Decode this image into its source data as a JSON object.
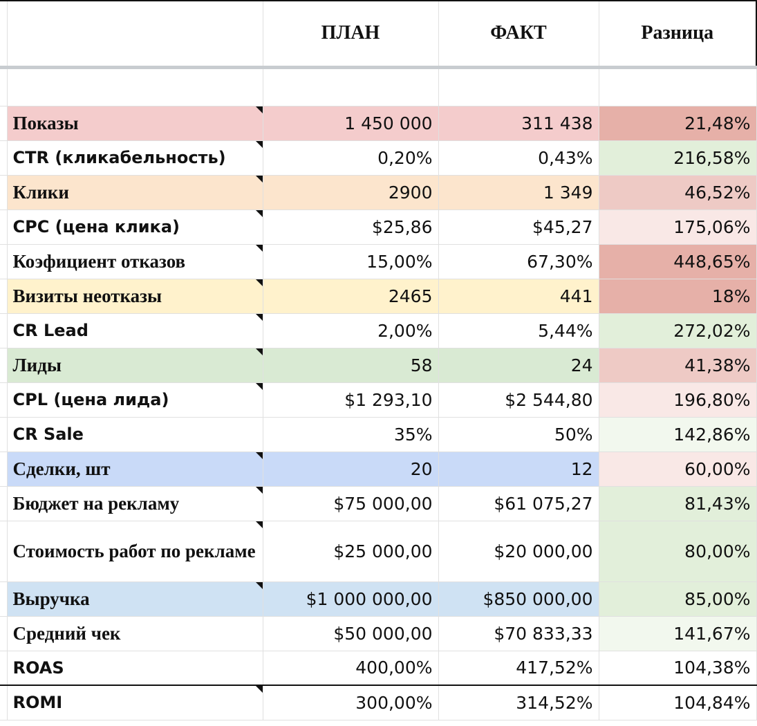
{
  "header": {
    "plan": "ПЛАН",
    "fact": "ФАКТ",
    "diff": "Разница"
  },
  "rows": [
    {
      "label": "Показы",
      "plan": "1 450 000",
      "fact": "311 438",
      "diff": "21,48%"
    },
    {
      "label": "CTR (кликабельность)",
      "plan": "0,20%",
      "fact": "0,43%",
      "diff": "216,58%"
    },
    {
      "label": "Клики",
      "plan": "2900",
      "fact": "1 349",
      "diff": "46,52%"
    },
    {
      "label": "CPC (цена клика)",
      "plan": "$25,86",
      "fact": "$45,27",
      "diff": "175,06%"
    },
    {
      "label": "Коэфициент отказов",
      "plan": "15,00%",
      "fact": "67,30%",
      "diff": "448,65%"
    },
    {
      "label": "Визиты неотказы",
      "plan": "2465",
      "fact": "441",
      "diff": "18%"
    },
    {
      "label": "CR Lead",
      "plan": "2,00%",
      "fact": "5,44%",
      "diff": "272,02%"
    },
    {
      "label": "Лиды",
      "plan": "58",
      "fact": "24",
      "diff": "41,38%"
    },
    {
      "label": "CPL (цена лида)",
      "plan": "$1 293,10",
      "fact": "$2 544,80",
      "diff": "196,80%"
    },
    {
      "label": "CR Sale",
      "plan": "35%",
      "fact": "50%",
      "diff": "142,86%"
    },
    {
      "label": "Сделки, шт",
      "plan": "20",
      "fact": "12",
      "diff": "60,00%"
    },
    {
      "label": "Бюджет на рекламу",
      "plan": "$75 000,00",
      "fact": "$61 075,27",
      "diff": "81,43%"
    },
    {
      "label": "Стоимость работ по рекламе",
      "plan": "$25 000,00",
      "fact": "$20 000,00",
      "diff": "80,00%"
    },
    {
      "label": "Выручка",
      "plan": "$1 000 000,00",
      "fact": "$850 000,00",
      "diff": "85,00%"
    },
    {
      "label": "Средний чек",
      "plan": "$50 000,00",
      "fact": "$70 833,33",
      "diff": "141,67%"
    },
    {
      "label": "ROAS",
      "plan": "400,00%",
      "fact": "417,52%",
      "diff": "104,38%"
    },
    {
      "label": "ROMI",
      "plan": "300,00%",
      "fact": "314,52%",
      "diff": "104,84%"
    }
  ],
  "colors": {
    "pink": "#f4cccc",
    "peach": "#fce5cd",
    "yellow": "#fff2cc",
    "green": "#d9ead3",
    "blue": "#c9daf8",
    "lightblue": "#cfe2f3",
    "diff_red_strong": "#e6b0a8",
    "diff_red_mid": "#eecac5",
    "diff_red_light": "#f9e8e6",
    "diff_green": "#e2efda",
    "diff_green_light": "#f2f8ee"
  }
}
